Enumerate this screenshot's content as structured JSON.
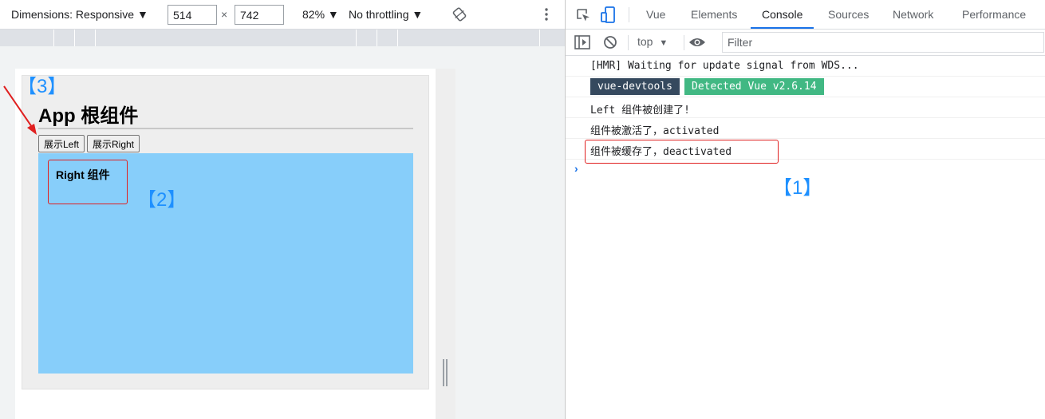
{
  "emulation": {
    "dimensions_label": "Dimensions: Responsive",
    "width_value": "514",
    "times": "×",
    "height_value": "742",
    "zoom": "82%",
    "throttling": "No throttling",
    "dropdown_caret": "▼"
  },
  "app": {
    "title": "App 根组件",
    "btn_left": "展示Left",
    "btn_right": "展示Right",
    "right_component": "Right 组件"
  },
  "markers": {
    "m1": "【1】",
    "m2": "【2】",
    "m3": "【3】"
  },
  "devtools": {
    "tabs": [
      "Vue",
      "Elements",
      "Console",
      "Sources",
      "Network",
      "Performance"
    ],
    "active_tab": "Console",
    "context": "top",
    "filter_placeholder": "Filter",
    "badge_left": "vue-devtools",
    "badge_right": "Detected Vue v2.6.14",
    "badge_left_color": "#35495e",
    "badge_right_color": "#41b883",
    "prompt_symbol": "›",
    "messages": [
      "[HMR] Waiting for update signal from WDS...",
      "Left 组件被创建了!",
      "组件被激活了，activated",
      "组件被缓存了，deactivated"
    ]
  },
  "colors": {
    "accent": "#1a73e8",
    "annotation_red": "#e02020",
    "marker_blue": "#1e90ff",
    "panel_blue": "#87cefa"
  }
}
